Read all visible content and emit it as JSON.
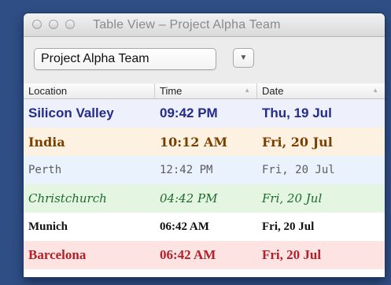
{
  "window": {
    "title": "Table View – Project Alpha Team"
  },
  "toolbar": {
    "team_selected": "Project Alpha Team",
    "dropdown_icon": "triangle-down-icon"
  },
  "table": {
    "columns": [
      "Location",
      "Time",
      "Date"
    ],
    "rows": [
      {
        "location": "Silicon Valley",
        "time": "09:42 PM",
        "date": "Thu, 19 Jul"
      },
      {
        "location": "India",
        "time": "10:12 AM",
        "date": "Fri, 20 Jul"
      },
      {
        "location": "Perth",
        "time": "12:42 PM",
        "date": "Fri, 20 Jul"
      },
      {
        "location": "Christchurch",
        "time": "04:42 PM",
        "date": "Fri, 20 Jul"
      },
      {
        "location": "Munich",
        "time": "06:42 AM",
        "date": "Fri, 20 Jul"
      },
      {
        "location": "Barcelona",
        "time": "06:42 AM",
        "date": "Fri, 20 Jul"
      }
    ]
  },
  "colors": {
    "silicon_valley": "#232b8b",
    "india": "#7b3f00",
    "perth": "#5d5d5d",
    "christchurch": "#1d6b2e",
    "munich": "#111111",
    "barcelona": "#b3202a"
  }
}
